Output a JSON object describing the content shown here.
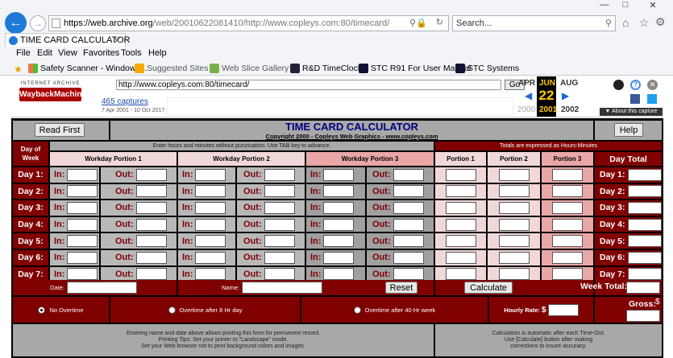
{
  "browser": {
    "url_domain": "https://web.archive.org",
    "url_rest": "/web/20010622081410/http://www.copleys.com:80/timecard/",
    "search_placeholder": "Search...",
    "tab_title": "TIME CARD CALCULATOR",
    "menu": [
      "File",
      "Edit",
      "View",
      "Favorites",
      "Tools",
      "Help"
    ],
    "favorites": [
      "Safety Scanner - Windows...",
      "Suggested Sites ▾",
      "Web Slice Gallery ▾",
      "R&D TimeClock",
      "STC R91 For User Manual",
      "STC Systems"
    ]
  },
  "wayback": {
    "logo_top": "INTERNET ARCHIVE",
    "logo_main": "WaybackMachine",
    "url_value": "http://www.copleys.com:80/timecard/",
    "go_label": "Go",
    "captures": "465 captures",
    "range": "7 Apr 2001 - 10 Oct 2017",
    "months": [
      "APR",
      "JUN",
      "AUG"
    ],
    "day": "22",
    "years": [
      "2000",
      "2001",
      "2002"
    ],
    "about": "▼ About this capture"
  },
  "app": {
    "read_first": "Read First",
    "help": "Help",
    "title": "TIME CARD CALCULATOR",
    "copyright": "Copyright 2000 - Copleys Web Graphics - www.copleys.com",
    "instructions": "Enter hours and minutes without punctuation. Use TAB key to advance.",
    "totals_note": "Totals are expressed as Hours:Minutes",
    "day_of_week": "Day of Week",
    "portions": [
      "Workday Portion 1",
      "Workday Portion 2",
      "Workday Portion 3"
    ],
    "portion_cols": [
      "Portion 1",
      "Portion 2",
      "Portion 3"
    ],
    "day_total": "Day Total",
    "in_label": "In:",
    "out_label": "Out:",
    "days": [
      "Day 1:",
      "Day 2:",
      "Day 3:",
      "Day 4:",
      "Day 5:",
      "Day 6:",
      "Day 7:"
    ],
    "date_label": "Date:",
    "name_label": "Name:",
    "reset": "Reset",
    "calculate": "Calculate",
    "week_total": "Week Total:",
    "overtime": [
      "No Overtime",
      "Overtime after 8 Hr day",
      "Overtime after 40 Hr week"
    ],
    "hourly_rate": "Hourly Rate:",
    "dollar": "$",
    "gross": "Gross:",
    "footer_left": [
      "Entering name and date above allows printing this form for permanent record.",
      "Printing Tips: Set your printer to \"Landscape\" mode.",
      "Set your Web browser not to print background colors and images."
    ],
    "footer_right": [
      "Calculation is automatic after each Time-Out.",
      "Use [Calculate] button after making",
      "corrections to insure accuracy."
    ]
  },
  "colors": {
    "dark_red": "#800000",
    "title_blue": "#000080",
    "gray": "#a8a8a8"
  }
}
